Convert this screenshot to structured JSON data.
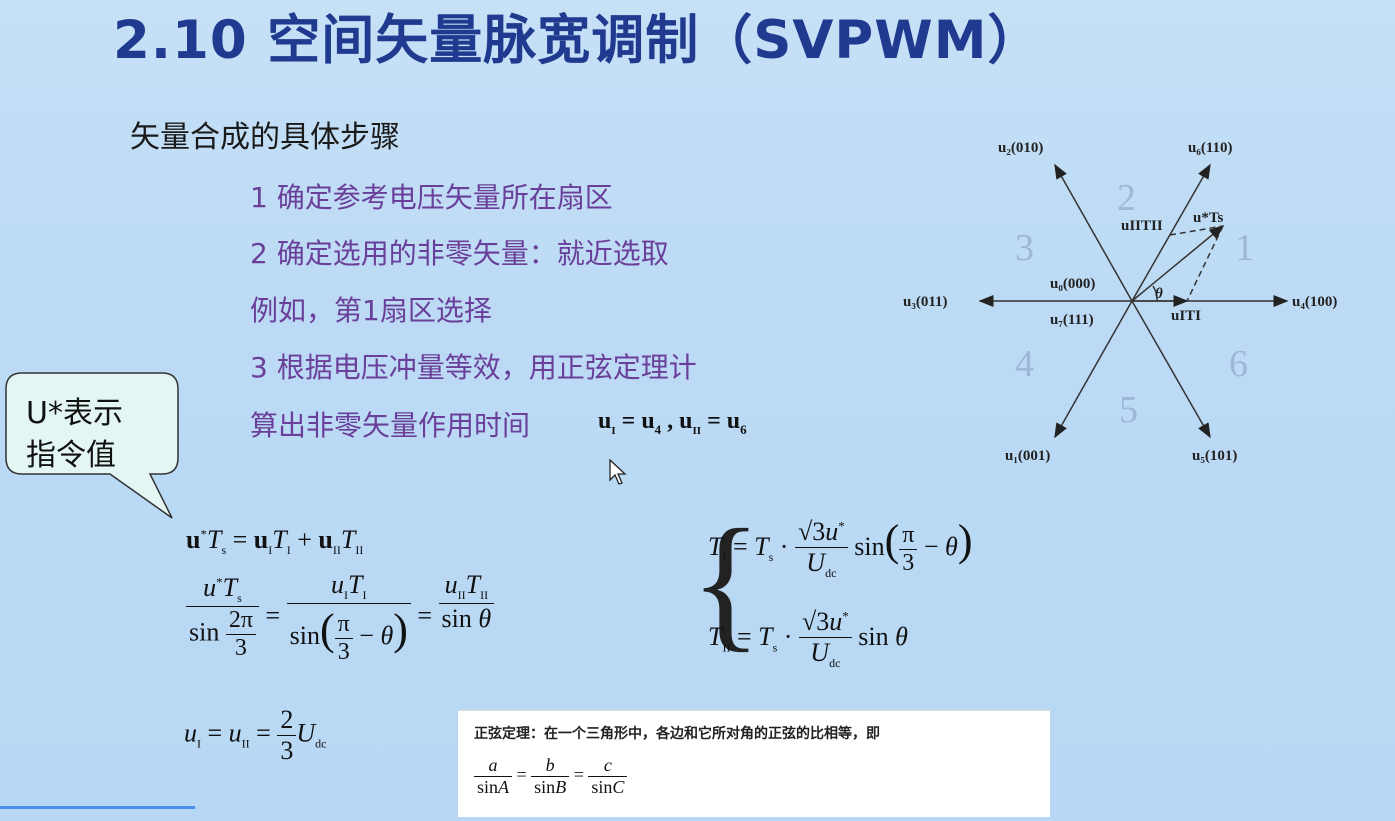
{
  "slide": {
    "title": "2.10 空间矢量脉宽调制（SVPWM）",
    "subtitle": "矢量合成的具体步骤",
    "steps": [
      "1 确定参考电压矢量所在扇区",
      "2 确定选用的非零矢量：就近选取",
      "例如，第1扇区选择",
      "3 根据电压冲量等效，用正弦定理计",
      "算出非零矢量作用时间"
    ],
    "callout": {
      "line1": "U*表示",
      "line2": "指令值"
    },
    "note": {
      "text": "正弦定理：在一个三角形中，各边和它所对角的正弦的比相等，即",
      "formula": "a/sinA = b/sinB = c/sinC"
    }
  },
  "diagram": {
    "vectors": [
      {
        "label": "u₄(100)"
      },
      {
        "label": "u₆(110)"
      },
      {
        "label": "u₂(010)"
      },
      {
        "label": "u₃(011)"
      },
      {
        "label": "u₁(001)"
      },
      {
        "label": "u₅(101)"
      }
    ],
    "sectors": [
      "1",
      "2",
      "3",
      "4",
      "5",
      "6"
    ],
    "zero_labels": [
      "u₀(000)",
      "u₇(111)"
    ],
    "components": {
      "ref": "u*Ts",
      "u1t1": "uITI",
      "u2t2": "uIITII",
      "angle": "θ"
    }
  },
  "colors": {
    "title": "#1f3a8f",
    "steps": "#6a3f9a",
    "sector": "#9fb6d6",
    "background": "#bcdaf5"
  },
  "icons": {
    "cursor": "mouse-pointer-icon"
  }
}
